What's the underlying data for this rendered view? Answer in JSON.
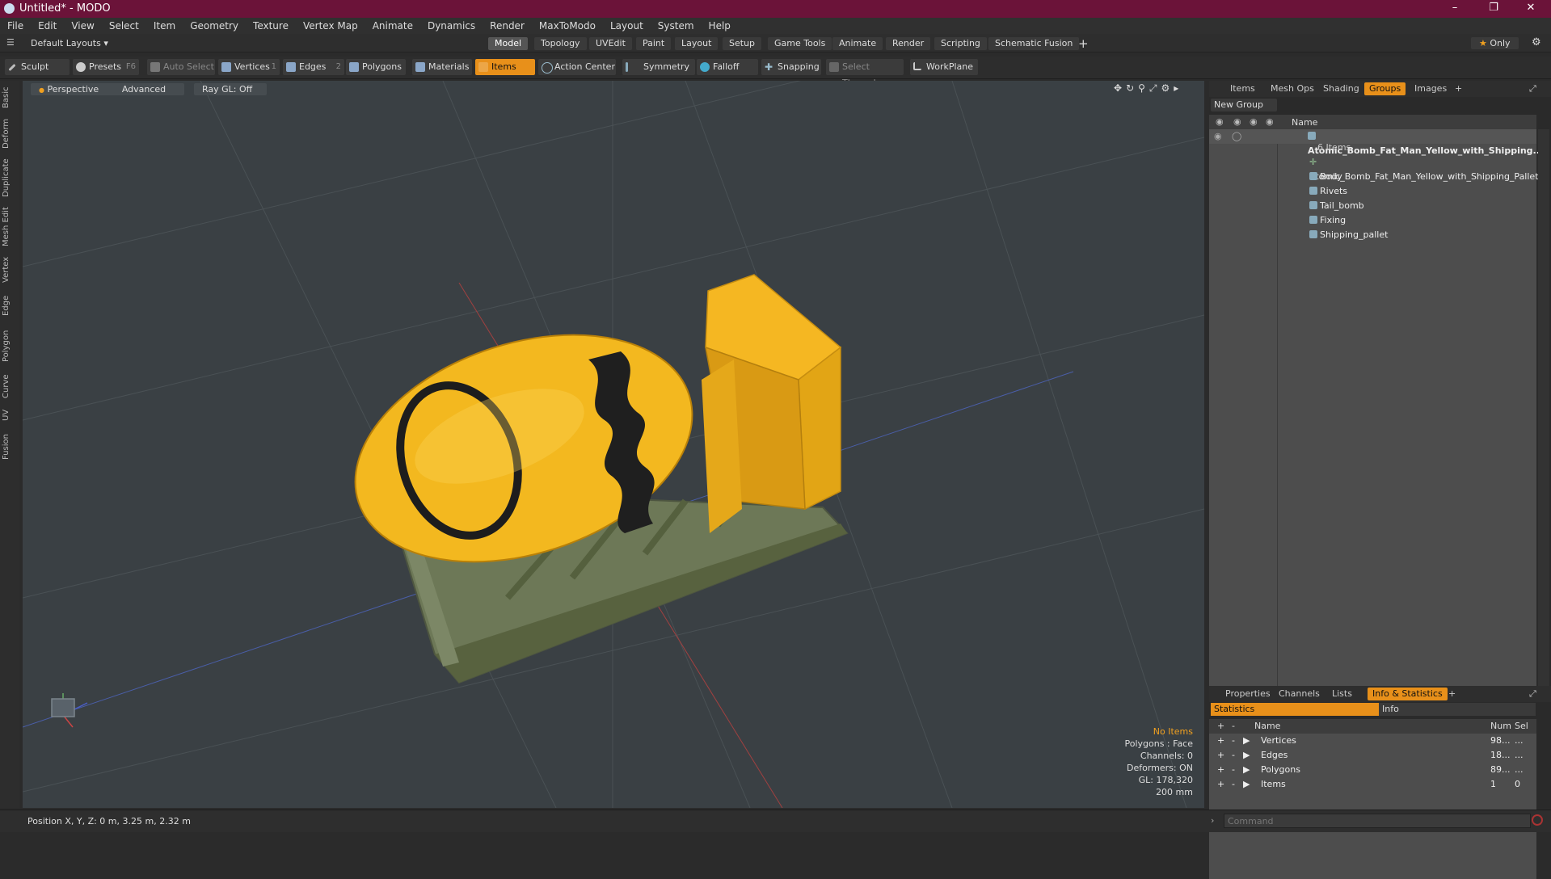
{
  "window": {
    "title": "Untitled* - MODO"
  },
  "menu": [
    "File",
    "Edit",
    "View",
    "Select",
    "Item",
    "Geometry",
    "Texture",
    "Vertex Map",
    "Animate",
    "Dynamics",
    "Render",
    "MaxToModo",
    "Layout",
    "System",
    "Help"
  ],
  "layout_selector": "Default Layouts",
  "layout_tabs": [
    "Model",
    "Topology",
    "UVEdit",
    "Paint",
    "Layout",
    "Setup",
    "Game Tools",
    "Animate",
    "Render",
    "Scripting",
    "Schematic Fusion"
  ],
  "layout_only": "Only",
  "toolbar": {
    "sculpt": "Sculpt",
    "presets": "Presets",
    "presets_key": "F6",
    "auto_select": "Auto Select",
    "vertices": "Vertices",
    "vertices_key": "1",
    "edges": "Edges",
    "edges_key": "2",
    "polygons": "Polygons",
    "materials": "Materials",
    "items": "Items",
    "action_center": "Action Center",
    "symmetry": "Symmetry",
    "falloff": "Falloff",
    "snapping": "Snapping",
    "select_through": "Select Through",
    "workplane": "WorkPlane"
  },
  "left_tabs": [
    "Basic",
    "Deform",
    "Duplicate",
    "Mesh Edit",
    "Vertex",
    "Edge",
    "Polygon",
    "Curve",
    "UV",
    "Fusion"
  ],
  "viewport": {
    "view_mode": "Perspective",
    "shading": "Advanced",
    "raygl": "Ray GL: Off",
    "hud": {
      "selection": "No Items",
      "polygons": "Polygons : Face",
      "channels": "Channels: 0",
      "deformers": "Deformers: ON",
      "gl": "GL: 178,320",
      "grid": "200 mm"
    }
  },
  "right_panel": {
    "tabs": [
      "Items",
      "Mesh Ops",
      "Shading",
      "Groups",
      "Images"
    ],
    "active_tab": "Groups",
    "new_group": "New Group",
    "column_name": "Name",
    "group": {
      "name": "Atomic_Bomb_Fat_Man_Yellow_with_Shipping...",
      "count": "6 Items",
      "children": [
        "Atomic_Bomb_Fat_Man_Yellow_with_Shipping_Pallet",
        "Body",
        "Rivets",
        "Tail_bomb",
        "Fixing",
        "Shipping_pallet"
      ]
    }
  },
  "bottom_panel": {
    "tabs": [
      "Properties",
      "Channels",
      "Lists",
      "Info & Statistics"
    ],
    "stat_tab": "Statistics",
    "info_tab": "Info",
    "columns": [
      "Name",
      "Num",
      "Sel"
    ],
    "rows": [
      {
        "name": "Vertices",
        "num": "98...",
        "sel": "..."
      },
      {
        "name": "Edges",
        "num": "18...",
        "sel": "..."
      },
      {
        "name": "Polygons",
        "num": "89...",
        "sel": "..."
      },
      {
        "name": "Items",
        "num": "1",
        "sel": "0"
      }
    ]
  },
  "status": {
    "position": "Position X, Y, Z:  0 m, 3.25 m, 2.32 m"
  },
  "command": {
    "placeholder": "Command"
  },
  "colors": {
    "title_bar": "#6b1339",
    "accent": "#e8901a",
    "bomb": "#f2b81e",
    "pallet": "#6f7a58"
  }
}
